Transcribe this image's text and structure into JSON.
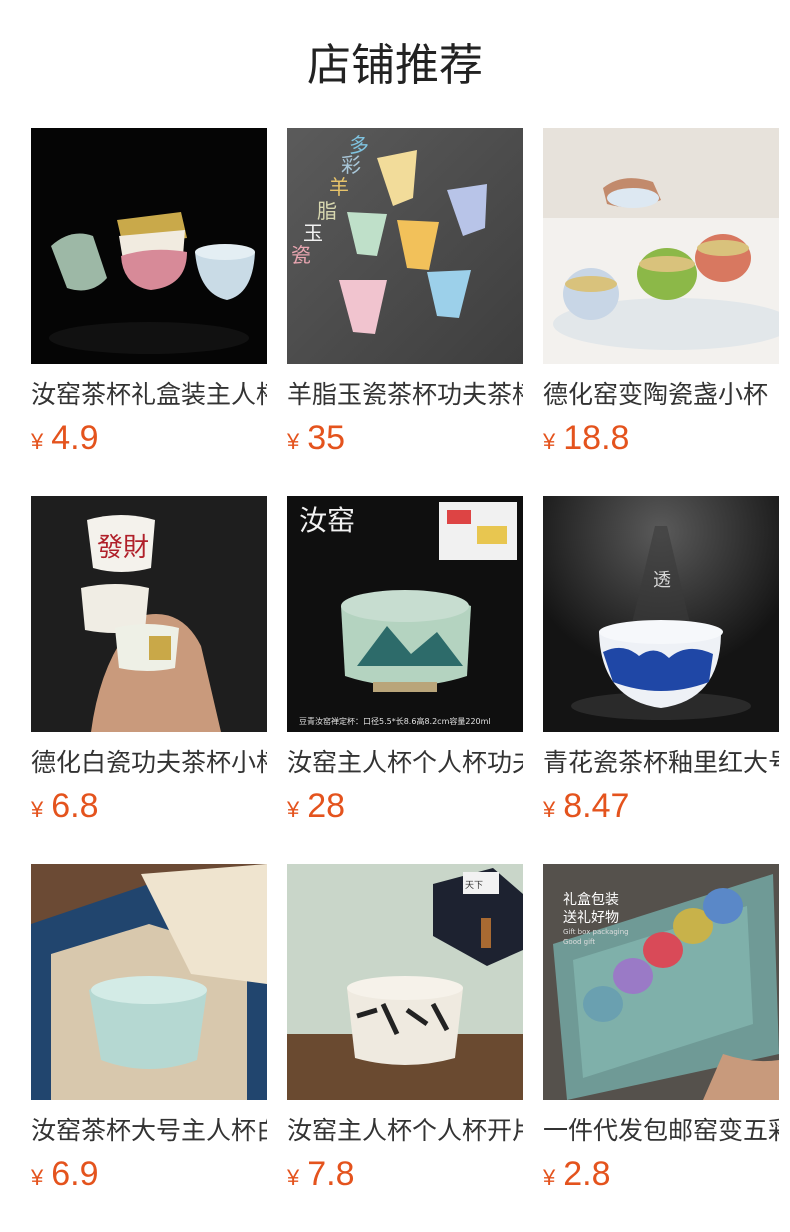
{
  "section": {
    "title": "店铺推荐"
  },
  "currency_symbol": "¥",
  "products": [
    {
      "name": "汝窑茶杯礼盒装主人杯",
      "price": "4.9"
    },
    {
      "name": "羊脂玉瓷茶杯功夫茶杯",
      "price": "35"
    },
    {
      "name": "德化窑变陶瓷盏小杯",
      "price": "18.8"
    },
    {
      "name": "德化白瓷功夫茶杯小杯",
      "price": "6.8"
    },
    {
      "name": "汝窑主人杯个人杯功夫",
      "price": "28"
    },
    {
      "name": "青花瓷茶杯釉里红大号",
      "price": "8.47"
    },
    {
      "name": "汝窑茶杯大号主人杯白",
      "price": "6.9"
    },
    {
      "name": "汝窑主人杯个人杯开片",
      "price": "7.8"
    },
    {
      "name": "一件代发包邮窑变五彩",
      "price": "2.8"
    }
  ],
  "image_text": {
    "p2": [
      "多",
      "彩",
      "羊",
      "脂",
      "玉",
      "瓷"
    ],
    "p4": [
      "發財"
    ],
    "p5": [
      "汝窑",
      "豆青汝窑禅定杯：口径5.5*长8.6高8.2cm容量220ml"
    ],
    "p6": [
      "透"
    ],
    "p8": [
      "天下"
    ],
    "p9": [
      "礼盒包装",
      "送礼好物",
      "Gift box packaging",
      "Good gift"
    ]
  }
}
